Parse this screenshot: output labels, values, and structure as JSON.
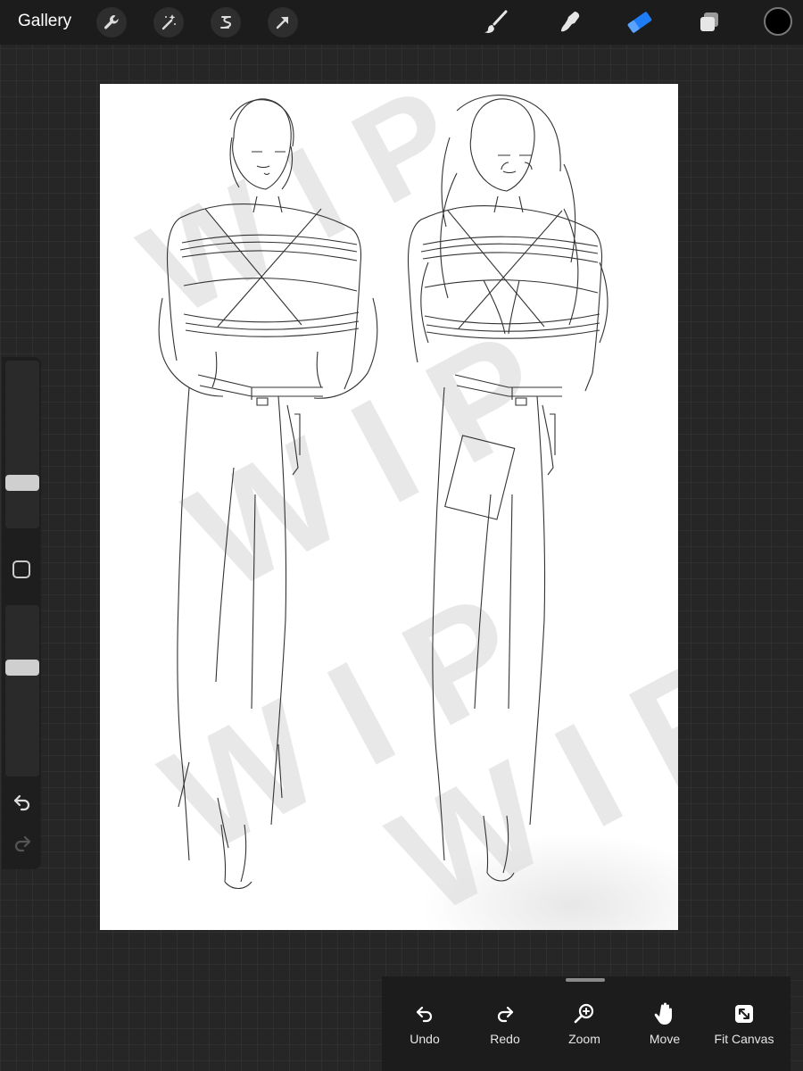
{
  "topbar": {
    "gallery_label": "Gallery",
    "left_tools": [
      "wrench-icon",
      "magic-wand-icon",
      "selection-icon",
      "transform-arrow-icon"
    ],
    "right_tools": [
      "brush-icon",
      "smudge-icon",
      "eraser-icon",
      "layers-icon"
    ],
    "active_tool": "eraser-icon",
    "accent_color": "#1e7cf5",
    "current_color": "#000000"
  },
  "canvas": {
    "watermark_text": "W I P"
  },
  "sidebar": {
    "brush_size_level": 0.25,
    "opacity_level": 0.65,
    "icons": [
      "modify-square-icon",
      "undo-icon",
      "redo-icon"
    ]
  },
  "bottom_panel": {
    "buttons": [
      {
        "label": "Undo",
        "icon": "undo-icon"
      },
      {
        "label": "Redo",
        "icon": "redo-icon"
      },
      {
        "label": "Zoom",
        "icon": "zoom-icon"
      },
      {
        "label": "Move",
        "icon": "hand-icon"
      },
      {
        "label": "Fit Canvas",
        "icon": "fit-canvas-icon"
      }
    ]
  }
}
